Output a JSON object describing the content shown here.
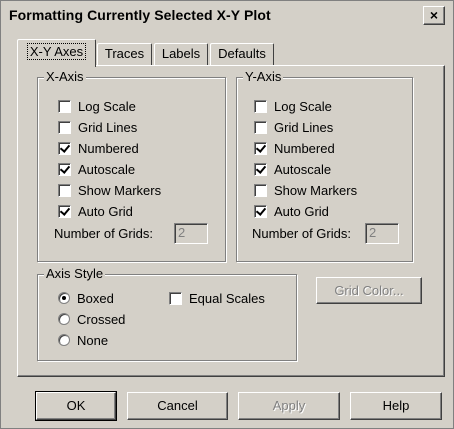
{
  "window": {
    "title": "Formatting Currently Selected X-Y Plot",
    "close_label": "×"
  },
  "tabs": [
    {
      "label": "X-Y Axes",
      "active": true
    },
    {
      "label": "Traces",
      "active": false
    },
    {
      "label": "Labels",
      "active": false
    },
    {
      "label": "Defaults",
      "active": false
    }
  ],
  "x_axis": {
    "title": "X-Axis",
    "options": [
      {
        "label": "Log Scale",
        "checked": false
      },
      {
        "label": "Grid Lines",
        "checked": false
      },
      {
        "label": "Numbered",
        "checked": true
      },
      {
        "label": "Autoscale",
        "checked": true
      },
      {
        "label": "Show Markers",
        "checked": false
      },
      {
        "label": "Auto Grid",
        "checked": true
      }
    ],
    "grids_label": "Number of Grids:",
    "grids_value": "2"
  },
  "y_axis": {
    "title": "Y-Axis",
    "options": [
      {
        "label": "Log Scale",
        "checked": false
      },
      {
        "label": "Grid Lines",
        "checked": false
      },
      {
        "label": "Numbered",
        "checked": true
      },
      {
        "label": "Autoscale",
        "checked": true
      },
      {
        "label": "Show Markers",
        "checked": false
      },
      {
        "label": "Auto Grid",
        "checked": true
      }
    ],
    "grids_label": "Number of Grids:",
    "grids_value": "2"
  },
  "axis_style": {
    "title": "Axis Style",
    "options": [
      {
        "label": "Boxed",
        "selected": true
      },
      {
        "label": "Crossed",
        "selected": false
      },
      {
        "label": "None",
        "selected": false
      }
    ],
    "equal_scales_label": "Equal Scales",
    "equal_scales_checked": false
  },
  "grid_color_label": "Grid Color...",
  "buttons": {
    "ok": "OK",
    "cancel": "Cancel",
    "apply": "Apply",
    "help": "Help"
  }
}
